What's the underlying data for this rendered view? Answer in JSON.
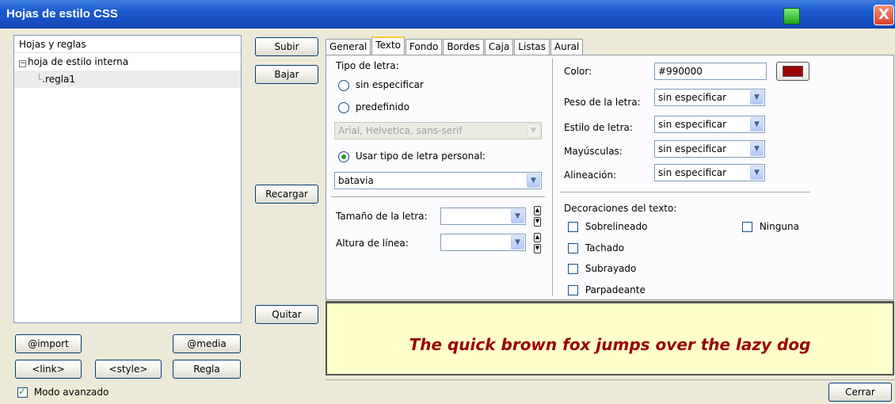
{
  "window": {
    "title": "Hojas de estilo CSS",
    "close_glyph": "X"
  },
  "tree": {
    "header": "Hojas y reglas",
    "items": [
      {
        "label": "hoja de estilo interna",
        "expander": "−"
      },
      {
        "label": ".regla1"
      }
    ]
  },
  "buttons": {
    "subir": "Subir",
    "bajar": "Bajar",
    "recargar": "Recargar",
    "quitar": "Quitar",
    "import": "@import",
    "media": "@media",
    "link": "<link>",
    "style": "<style>",
    "regla": "Regla",
    "cerrar": "Cerrar"
  },
  "advanced_mode": {
    "label": "Modo avanzado",
    "checked": true
  },
  "tabs": [
    "General",
    "Texto",
    "Fondo",
    "Bordes",
    "Caja",
    "Listas",
    "Aural"
  ],
  "active_tab": "Texto",
  "font": {
    "section_label": "Tipo de letra:",
    "opt_unspecified": "sin especificar",
    "opt_predefined": "predefinido",
    "predefined_value": "Arial, Helvetica, sans-serif",
    "opt_custom": "Usar tipo de letra personal:",
    "custom_value": "batavia",
    "size_label": "Tamaño de la letra:",
    "size_value": "",
    "line_height_label": "Altura de línea:",
    "line_height_value": ""
  },
  "props": {
    "color_label": "Color:",
    "color_value": "#990000",
    "color_swatch": "#990000",
    "weight_label": "Peso de la letra:",
    "weight_value": "sin especificar",
    "style_label": "Estilo de letra:",
    "style_value": "sin especificar",
    "caps_label": "Mayúsculas:",
    "caps_value": "sin especificar",
    "align_label": "Alineación:",
    "align_value": "sin especificar"
  },
  "decorations": {
    "label": "Decoraciones del texto:",
    "overline": "Sobrelineado",
    "strike": "Tachado",
    "underline": "Subrayado",
    "blink": "Parpadeante",
    "none": "Ninguna"
  },
  "preview_text": "The quick brown fox jumps over the lazy dog"
}
